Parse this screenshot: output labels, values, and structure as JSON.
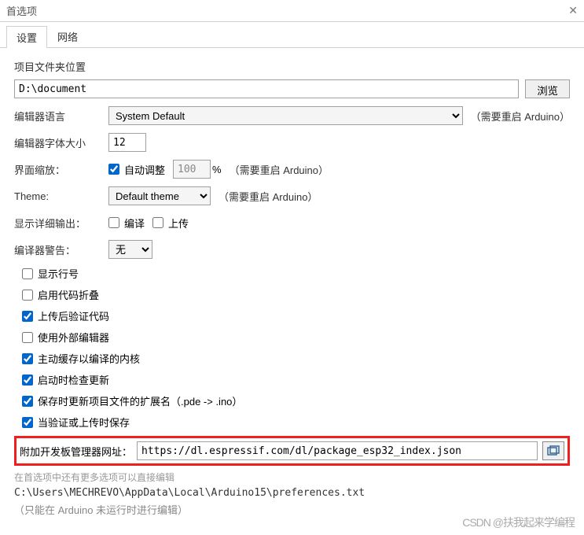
{
  "window": {
    "title": "首选项"
  },
  "tabs": {
    "settings": "设置",
    "network": "网络"
  },
  "sketch_location": {
    "label": "项目文件夹位置",
    "value": "D:\\document",
    "browse": "浏览"
  },
  "editor_lang": {
    "label": "编辑器语言",
    "value": "System Default",
    "hint": "（需要重启 Arduino）"
  },
  "font_size": {
    "label": "编辑器字体大小",
    "value": "12"
  },
  "scale": {
    "label": "界面缩放：",
    "auto": "自动调整",
    "value": "100",
    "unit": "%",
    "hint": "（需要重启 Arduino）"
  },
  "theme": {
    "label": "Theme:",
    "value": "Default theme",
    "hint": "（需要重启 Arduino）"
  },
  "verbose": {
    "label": "显示详细输出：",
    "compile": "编译",
    "upload": "上传"
  },
  "warnings": {
    "label": "编译器警告：",
    "value": "无"
  },
  "checks": {
    "line_numbers": "显示行号",
    "code_fold": "启用代码折叠",
    "verify_upload": "上传后验证代码",
    "external_editor": "使用外部编辑器",
    "cache_cores": "主动缓存以编译的内核",
    "check_updates": "启动时检查更新",
    "update_ext": "保存时更新项目文件的扩展名（.pde -> .ino）",
    "save_verify": "当验证或上传时保存"
  },
  "boards_url": {
    "label": "附加开发板管理器网址：",
    "value": "https://dl.espressif.com/dl/package_esp32_index.json"
  },
  "footer": {
    "more_hint": "在首选项中还有更多选项可以直接编辑",
    "path": "C:\\Users\\MECHREVO\\AppData\\Local\\Arduino15\\preferences.txt",
    "note": "（只能在 Arduino 未运行时进行编辑）"
  },
  "watermark": "CSDN @扶我起来学编程"
}
